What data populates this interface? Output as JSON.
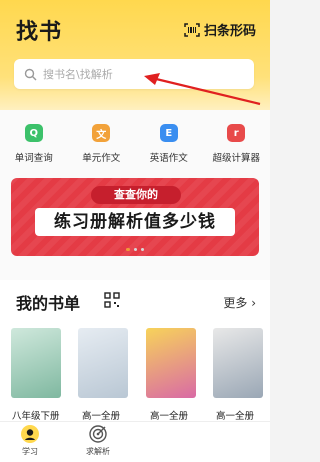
{
  "header": {
    "title": "找书",
    "scan_label": "扫条形码"
  },
  "search": {
    "placeholder": "搜书名\\找解析"
  },
  "tools": [
    {
      "label": "单词查询",
      "icon": "word-query-icon",
      "glyph": "Q",
      "color": "#3cc16a"
    },
    {
      "label": "单元作文",
      "icon": "unit-essay-icon",
      "glyph": "文",
      "color": "#f2a23a"
    },
    {
      "label": "英语作文",
      "icon": "english-essay-icon",
      "glyph": "E",
      "color": "#3a8ef0"
    },
    {
      "label": "超级计算器",
      "icon": "calculator-icon",
      "glyph": "r",
      "color": "#e84a4a"
    }
  ],
  "banner": {
    "top_text": "查查你的",
    "main_text": "练习册解析值多少钱"
  },
  "bookshelf": {
    "title": "我的书单",
    "more_label": "更多",
    "books": [
      {
        "label": "八年级下册",
        "cover_color": "#7fb8a0"
      },
      {
        "label": "高一全册",
        "cover_color": "#b9c7d4"
      },
      {
        "label": "高一全册",
        "cover_color": "#d96aa5"
      },
      {
        "label": "高一全册",
        "cover_color": "#9aa7b5"
      }
    ]
  },
  "tabbar": {
    "tabs": [
      {
        "label": "学习",
        "icon": "study-icon"
      },
      {
        "label": "求解析",
        "icon": "target-icon"
      }
    ]
  },
  "colors": {
    "brand_yellow": "#ffd84e",
    "banner_red": "#e43b45",
    "arrow_red": "#e02020"
  }
}
